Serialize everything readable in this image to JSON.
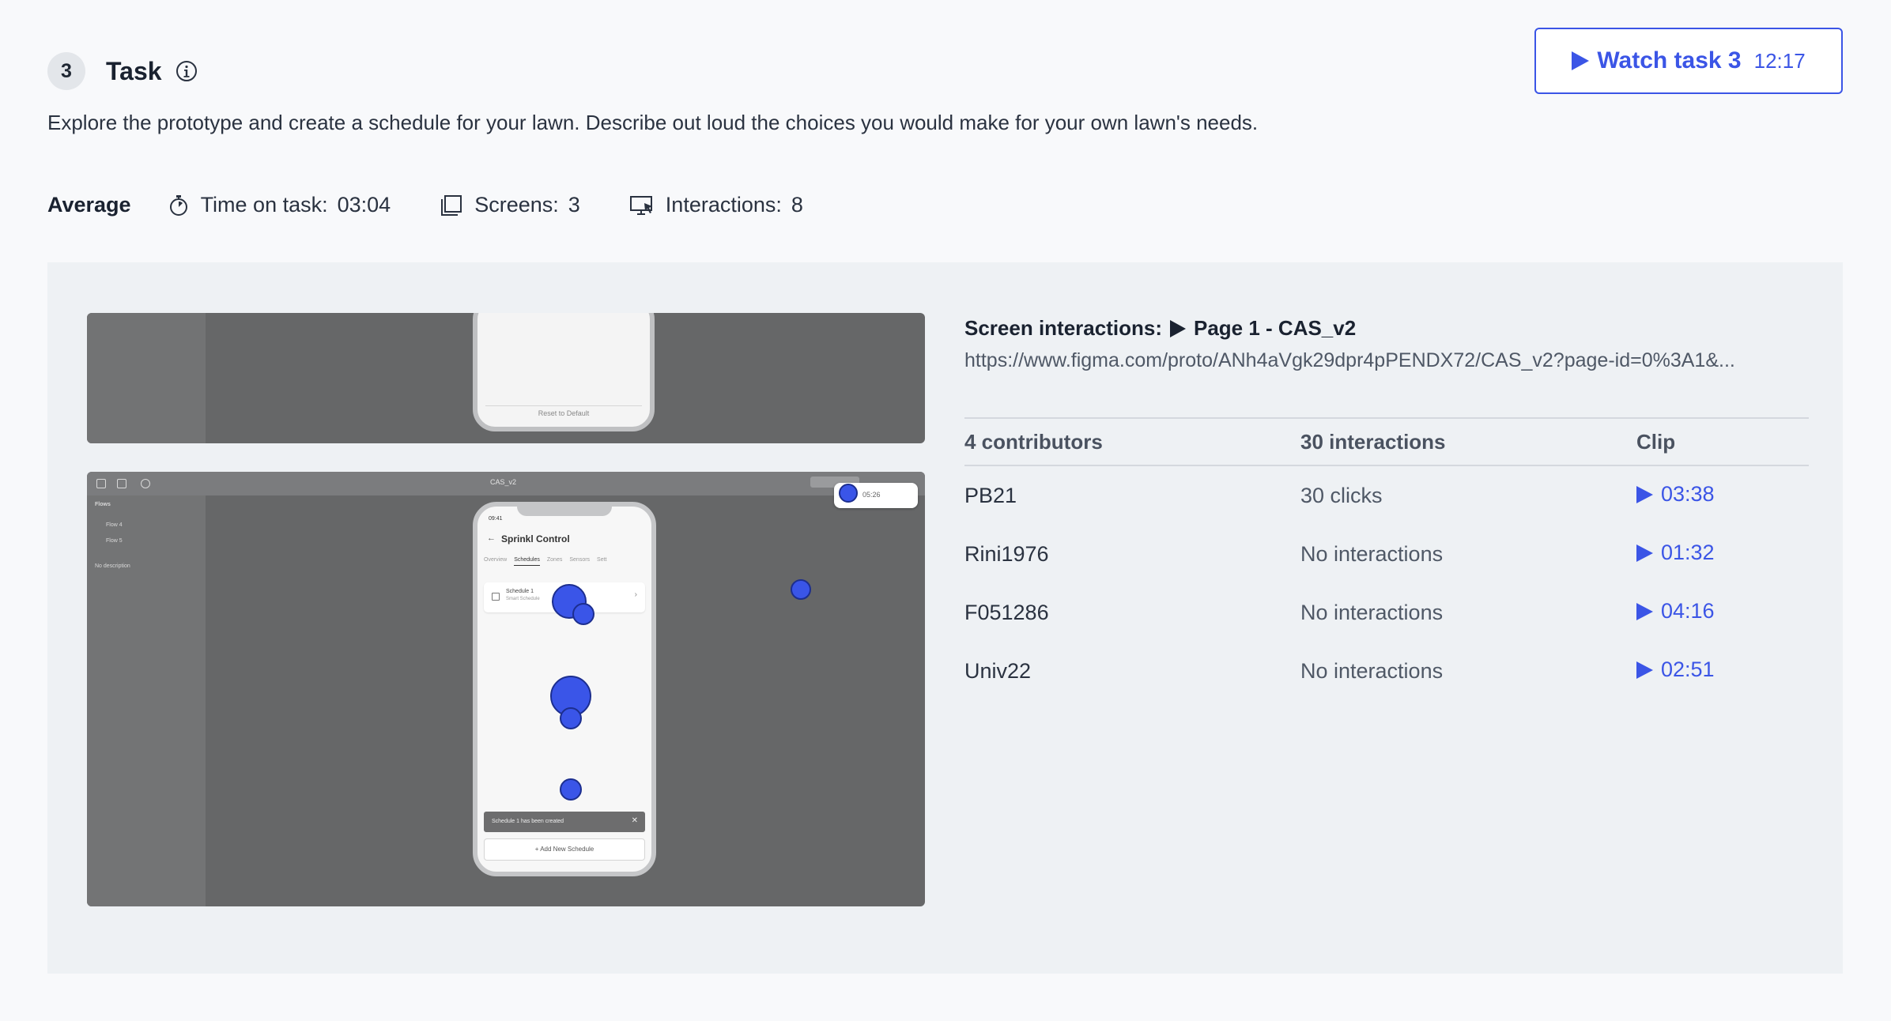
{
  "task": {
    "number": "3",
    "title": "Task",
    "description": "Explore the prototype and create a schedule for your lawn. Describe out loud the choices you would make for your own lawn's needs."
  },
  "watch_button": {
    "label": "Watch task 3",
    "duration": "12:17"
  },
  "average": {
    "label": "Average",
    "time_on_task_label": "Time on task:",
    "time_on_task_value": "03:04",
    "screens_label": "Screens:",
    "screens_value": "3",
    "interactions_label": "Interactions:",
    "interactions_value": "8"
  },
  "thumbnail": {
    "top_reset_label": "Reset to Default",
    "file_name": "CAS_v2",
    "sidebar_title": "Flows",
    "flow_4": "Flow 4",
    "flow_5": "Flow 5",
    "no_description": "No description",
    "rec_time": "05:26",
    "phone_status_time": "09:41",
    "app_title": "Sprinkl Control",
    "tabs": [
      "Overview",
      "Schedules",
      "Zones",
      "Sensors",
      "Sett"
    ],
    "schedule_name": "Schedule 1",
    "schedule_sub": "Smart Schedule",
    "toast": "Schedule 1 has been created",
    "add_button": "+ Add New Schedule"
  },
  "screen_interactions": {
    "label": "Screen interactions:",
    "page": "Page 1 - CAS_v2",
    "url": "https://www.figma.com/proto/ANh4aVgk29dpr4pPENDX72/CAS_v2?page-id=0%3A1&..."
  },
  "table": {
    "headers": [
      "4 contributors",
      "30 interactions",
      "Clip"
    ],
    "rows": [
      {
        "contributor": "PB21",
        "interactions": "30 clicks",
        "clip": "03:38"
      },
      {
        "contributor": "Rini1976",
        "interactions": "No interactions",
        "clip": "01:32"
      },
      {
        "contributor": "F051286",
        "interactions": "No interactions",
        "clip": "04:16"
      },
      {
        "contributor": "Univ22",
        "interactions": "No interactions",
        "clip": "02:51"
      }
    ]
  },
  "colors": {
    "accent": "#3b55e6",
    "panel_bg": "#eef1f4",
    "click_dot": "#3a55e8"
  }
}
